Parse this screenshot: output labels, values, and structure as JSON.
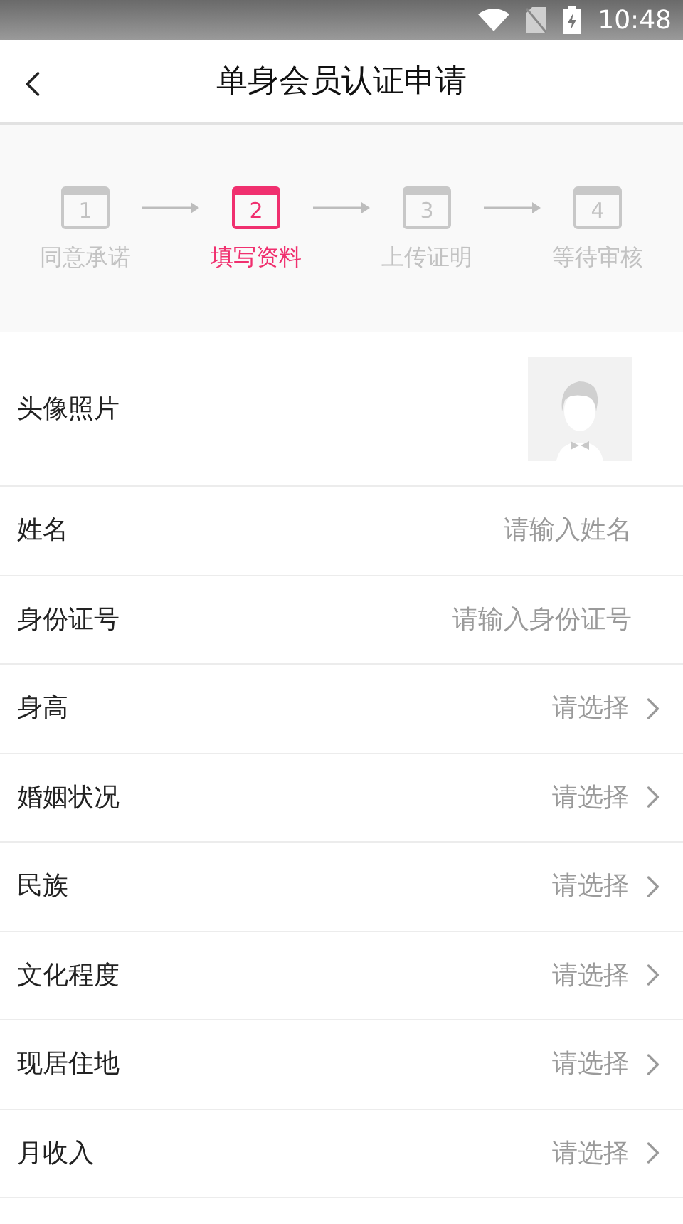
{
  "status_bar": {
    "time": "10:48"
  },
  "header": {
    "title": "单身会员认证申请"
  },
  "steps": [
    {
      "number": "1",
      "label": "同意承诺",
      "selected": false
    },
    {
      "number": "2",
      "label": "填写资料",
      "selected": true
    },
    {
      "number": "3",
      "label": "上传证明",
      "selected": false
    },
    {
      "number": "4",
      "label": "等待审核",
      "selected": false
    }
  ],
  "form_rows": [
    {
      "kind": "photo",
      "label": "头像照片"
    },
    {
      "kind": "input",
      "label": "姓名",
      "placeholder": "请输入姓名"
    },
    {
      "kind": "input",
      "label": "身份证号",
      "placeholder": "请输入身份证号"
    },
    {
      "kind": "select",
      "label": "身高",
      "value": "请选择"
    },
    {
      "kind": "select",
      "label": "婚姻状况",
      "value": "请选择"
    },
    {
      "kind": "select",
      "label": "民族",
      "value": "请选择"
    },
    {
      "kind": "select",
      "label": "文化程度",
      "value": "请选择"
    },
    {
      "kind": "select",
      "label": "现居住地",
      "value": "请选择"
    },
    {
      "kind": "select",
      "label": "月收入",
      "value": "请选择"
    }
  ]
}
